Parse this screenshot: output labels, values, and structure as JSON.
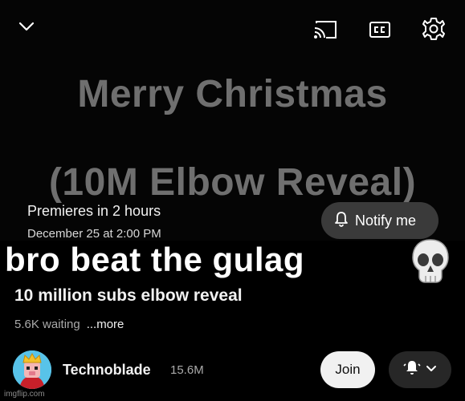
{
  "player": {
    "thumbnail_text": {
      "line1": "Merry Christmas",
      "line2": "(10M Elbow Reveal)"
    },
    "premiere": {
      "status": "Premieres in 2 hours",
      "date": "December 25 at 2:00 PM",
      "notify_label": "Notify me"
    },
    "icons": [
      "chevron-down-icon",
      "cast-icon",
      "closed-captions-icon",
      "gear-icon"
    ]
  },
  "meme": {
    "caption": "bro beat the gulag",
    "emoji_icon": "skull-icon"
  },
  "video": {
    "title": "10 million subs elbow reveal",
    "waiting": "5.6K waiting",
    "more_label": "...more"
  },
  "channel": {
    "name": "Technoblade",
    "subscribers": "15.6M",
    "join_label": "Join"
  },
  "watermark": "imgflip.com",
  "colors": {
    "background": "#000000",
    "notify_bg": "#3a3a3a",
    "join_bg": "#f1f1f1",
    "bell_bg": "#272727",
    "muted_text": "#aaaaaa"
  }
}
